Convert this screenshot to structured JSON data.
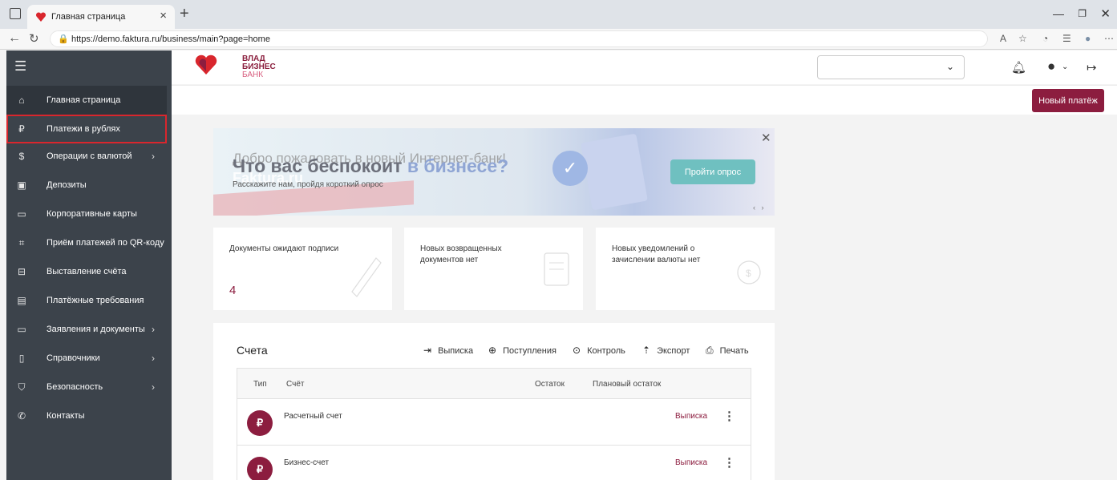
{
  "browser": {
    "tab_title": "Главная страница",
    "url": "https://demo.faktura.ru/business/main?page=home"
  },
  "sidebar": {
    "items": [
      {
        "label": "Главная страница",
        "icon": "home-icon"
      },
      {
        "label": "Платежи в рублях",
        "icon": "ruble-icon"
      },
      {
        "label": "Операции с валютой",
        "icon": "dollar-icon"
      },
      {
        "label": "Депозиты",
        "icon": "deposit-icon"
      },
      {
        "label": "Корпоративные карты",
        "icon": "card-icon"
      },
      {
        "label": "Приём платежей по QR-коду",
        "icon": "qr-icon"
      },
      {
        "label": "Выставление счёта",
        "icon": "invoice-icon"
      },
      {
        "label": "Платёжные требования",
        "icon": "document-icon"
      },
      {
        "label": "Заявления и документы",
        "icon": "folder-icon"
      },
      {
        "label": "Справочники",
        "icon": "book-icon"
      },
      {
        "label": "Безопасность",
        "icon": "shield-icon"
      },
      {
        "label": "Контакты",
        "icon": "phone-icon"
      }
    ]
  },
  "header": {
    "logo_line1": "ВЛАД",
    "logo_line2": "БИЗНЕС",
    "logo_line3": "БАНК",
    "new_payment": "Новый платёж"
  },
  "banner": {
    "ghost_text": "Добро пожаловать в новый Интернет-банк!",
    "headline_part1": "Что вас беспокоит ",
    "headline_part2": "в бизнесе?",
    "watermark": "Faktura.ru",
    "subtitle": "Расскажите нам, пройдя короткий опрос",
    "button": "Пройти опрос"
  },
  "cards": [
    {
      "text": "Документы ожидают подписи",
      "count": "4"
    },
    {
      "text": "Новых возвращенных документов нет",
      "count": ""
    },
    {
      "text": "Новых уведомлений о зачислении валюты нет",
      "count": ""
    }
  ],
  "accounts": {
    "title": "Счета",
    "actions": [
      "Выписка",
      "Поступления",
      "Контроль",
      "Экспорт",
      "Печать"
    ],
    "columns": [
      "Тип",
      "Счёт",
      "Остаток",
      "Плановый остаток"
    ],
    "rows": [
      {
        "name": "Расчетный счет",
        "action": "Выписка",
        "symbol": "₽"
      },
      {
        "name": "Бизнес-счет",
        "action": "Выписка",
        "symbol": "₽"
      }
    ]
  },
  "colors": {
    "brand": "#8c1d3f",
    "sidebar": "#3c434b",
    "highlight": "#d9262d",
    "survey_button": "#6fc0c0"
  }
}
